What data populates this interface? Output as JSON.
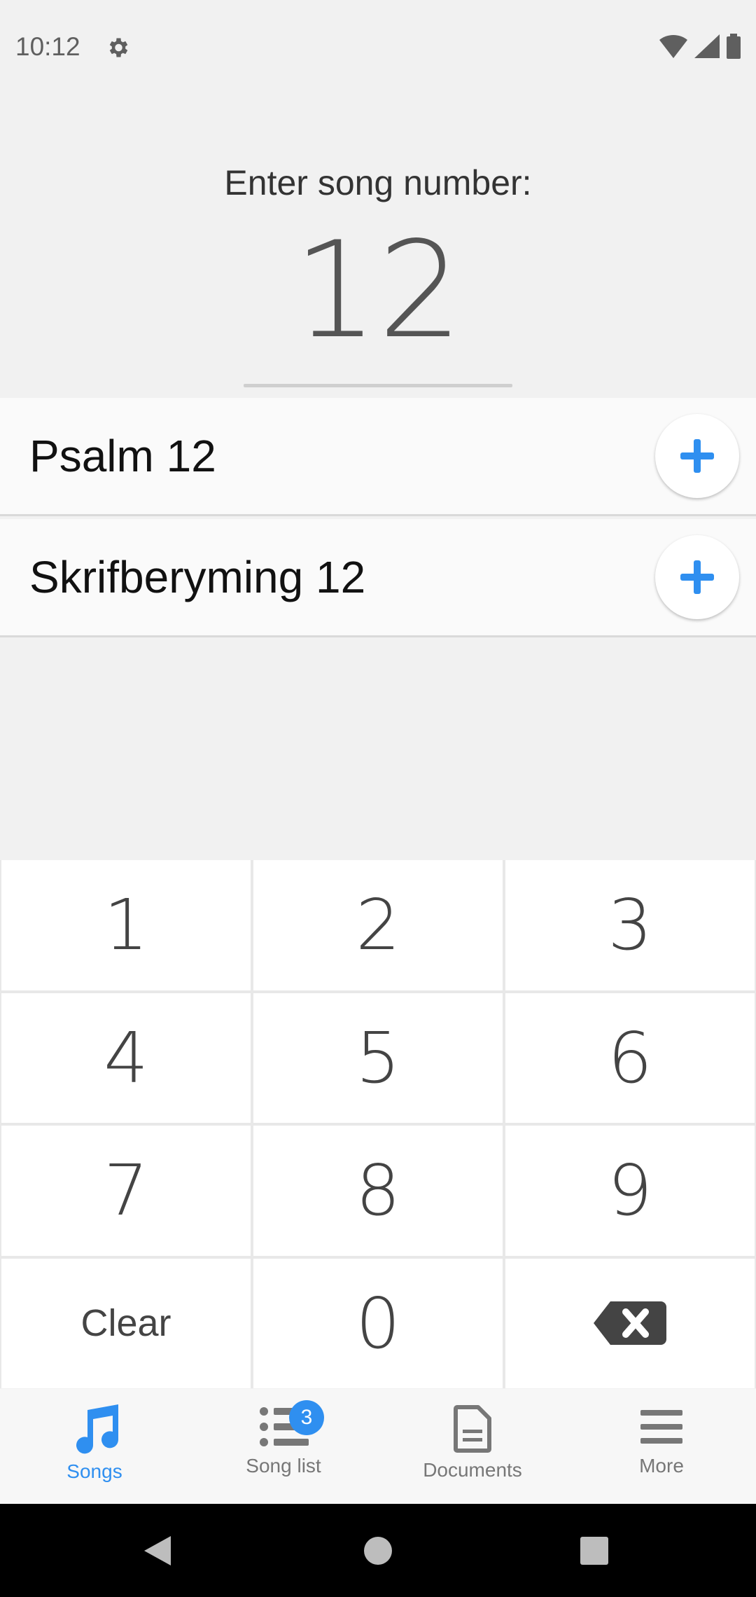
{
  "status_bar": {
    "time": "10:12"
  },
  "prompt": "Enter song number:",
  "entered_number": "12",
  "results": [
    {
      "label": "Psalm 12"
    },
    {
      "label": "Skrifberyming 12"
    }
  ],
  "keypad": {
    "keys": [
      "1",
      "2",
      "3",
      "4",
      "5",
      "6",
      "7",
      "8",
      "9",
      "Clear",
      "0"
    ],
    "backspace_icon": "backspace-icon"
  },
  "bottom_nav": {
    "items": [
      {
        "label": "Songs",
        "icon": "music-note-icon",
        "active": true
      },
      {
        "label": "Song list",
        "icon": "list-icon",
        "badge": "3"
      },
      {
        "label": "Documents",
        "icon": "document-icon"
      },
      {
        "label": "More",
        "icon": "menu-icon"
      }
    ]
  },
  "colors": {
    "accent": "#2f8ff0",
    "background": "#f1f1f1"
  }
}
